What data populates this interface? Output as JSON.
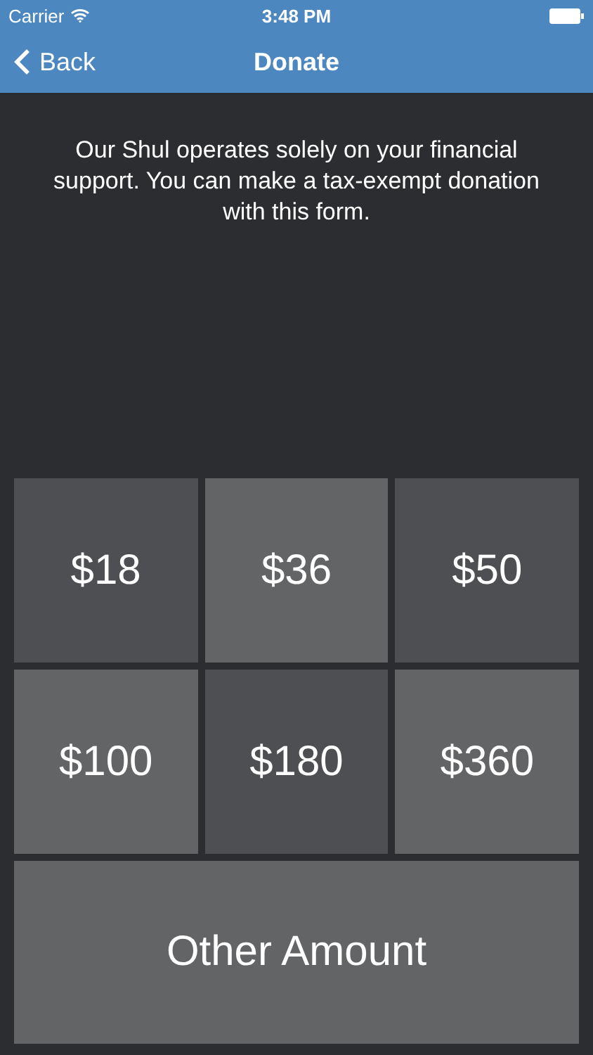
{
  "status_bar": {
    "carrier": "Carrier",
    "time": "3:48 PM"
  },
  "nav_bar": {
    "back": "Back",
    "title": "Donate"
  },
  "intro": "Our Shul operates solely on your financial support.  You can make a tax-exempt donation with this form.",
  "amounts": [
    "$18",
    "$36",
    "$50",
    "$100",
    "$180",
    "$360"
  ],
  "other_button": "Other Amount"
}
